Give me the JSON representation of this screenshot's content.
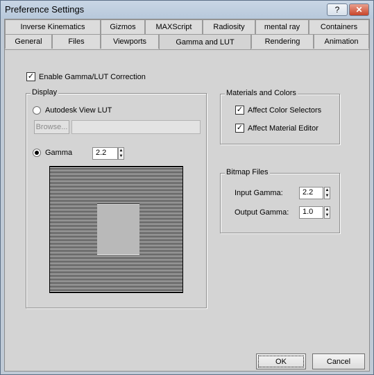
{
  "window": {
    "title": "Preference Settings",
    "help_label": "?",
    "close_label": "✕"
  },
  "tabs": {
    "row1": [
      "Inverse Kinematics",
      "Gizmos",
      "MAXScript",
      "Radiosity",
      "mental ray",
      "Containers"
    ],
    "row2": [
      "General",
      "Files",
      "Viewports",
      "Gamma and LUT",
      "Rendering",
      "Animation"
    ],
    "active": "Gamma and LUT"
  },
  "enable": {
    "label": "Enable Gamma/LUT Correction",
    "checked": true
  },
  "display": {
    "title": "Display",
    "lut_label": "Autodesk View LUT",
    "browse_label": "Browse...",
    "gamma_label": "Gamma",
    "gamma_value": "2.2"
  },
  "materials": {
    "title": "Materials and Colors",
    "color_selectors": "Affect Color Selectors",
    "material_editor": "Affect Material Editor"
  },
  "bitmap": {
    "title": "Bitmap Files",
    "input_label": "Input Gamma:",
    "input_value": "2.2",
    "output_label": "Output Gamma:",
    "output_value": "1.0"
  },
  "footer": {
    "ok": "OK",
    "cancel": "Cancel"
  }
}
